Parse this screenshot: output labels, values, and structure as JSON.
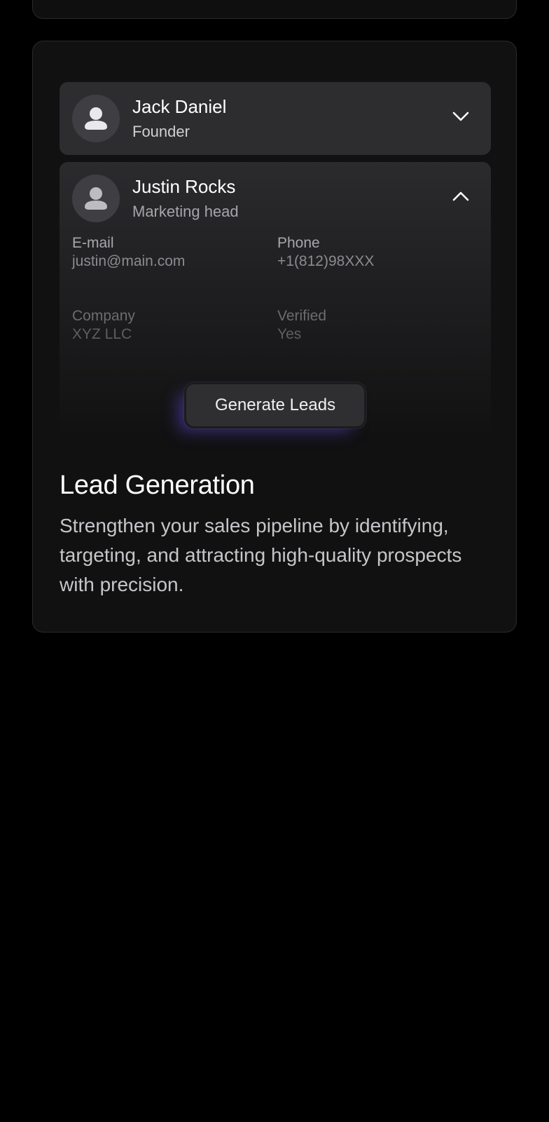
{
  "contacts": [
    {
      "name": "Jack Daniel",
      "role": "Founder",
      "avatar_icon": "user-icon",
      "toggle_icon": "chevron-down-icon",
      "expanded": false
    },
    {
      "name": "Justin Rocks",
      "role": "Marketing head",
      "avatar_icon": "user-icon",
      "toggle_icon": "chevron-up-icon",
      "expanded": true,
      "details": {
        "email_label": "E-mail",
        "email_value": "justin@main.com",
        "phone_label": "Phone",
        "phone_value": "+1(812)98XXX",
        "company_label": "Company",
        "company_value": "XYZ LLC",
        "verified_label": "Verified",
        "verified_value": "Yes"
      }
    }
  ],
  "action": {
    "generate_label": "Generate Leads"
  },
  "feature": {
    "title": "Lead Generation",
    "description": "Strengthen your sales pipeline by identifying, targeting, and attracting high-quality prospects with precision."
  },
  "colors": {
    "background": "#000000",
    "card": "#111112",
    "card_border": "#2a2a2c",
    "row": "#2d2d30",
    "button": "#2f2f32",
    "glow": "#5a46c8"
  }
}
